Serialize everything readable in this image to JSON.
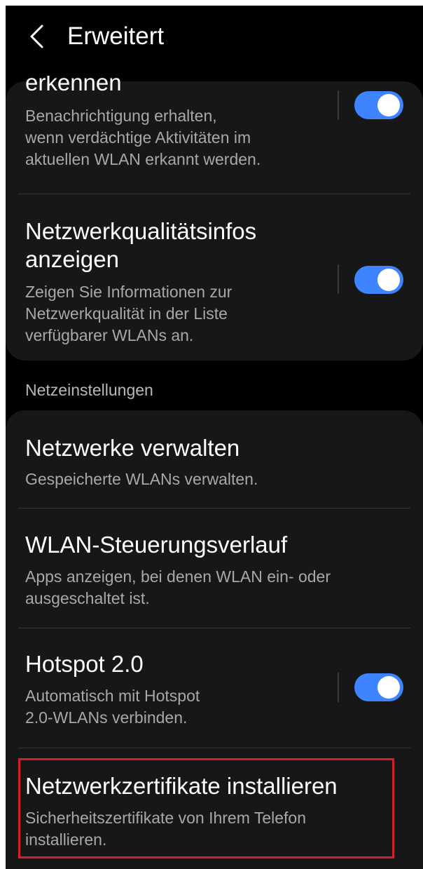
{
  "header": {
    "title": "Erweitert",
    "back_icon": "chevron-left-icon"
  },
  "wlan_section": {
    "items": [
      {
        "title": "erkennen",
        "description_lines": [
          "Benachrichtigung erhalten,",
          "wenn verdächtige Aktivitäten im",
          "aktuellen WLAN erkannt werden."
        ],
        "toggle_on": true
      },
      {
        "title_lines": [
          "Netzwerkqualitätsinfos",
          "anzeigen"
        ],
        "description_lines": [
          "Zeigen Sie Informationen zur",
          "Netzwerkqualität in der Liste",
          "verfügbarer WLANs an."
        ],
        "toggle_on": true
      }
    ]
  },
  "network_settings": {
    "header": "Netzeinstellungen",
    "items": [
      {
        "title": "Netzwerke verwalten",
        "description_lines": [
          "Gespeicherte WLANs verwalten."
        ]
      },
      {
        "title": "WLAN-Steuerungsverlauf",
        "description_lines": [
          "Apps anzeigen, bei denen WLAN ein- oder",
          "ausgeschaltet ist."
        ]
      },
      {
        "title": "Hotspot 2.0",
        "description_lines": [
          "Automatisch mit Hotspot",
          "2.0-WLANs verbinden."
        ],
        "toggle_on": true
      },
      {
        "title": "Netzwerkzertifikate installieren",
        "description_lines": [
          "Sicherheitszertifikate von Ihrem Telefon",
          "installieren."
        ]
      }
    ]
  },
  "colors": {
    "background": "#000000",
    "card": "#171717",
    "accent": "#3f84ff",
    "highlight": "#d0202a"
  }
}
